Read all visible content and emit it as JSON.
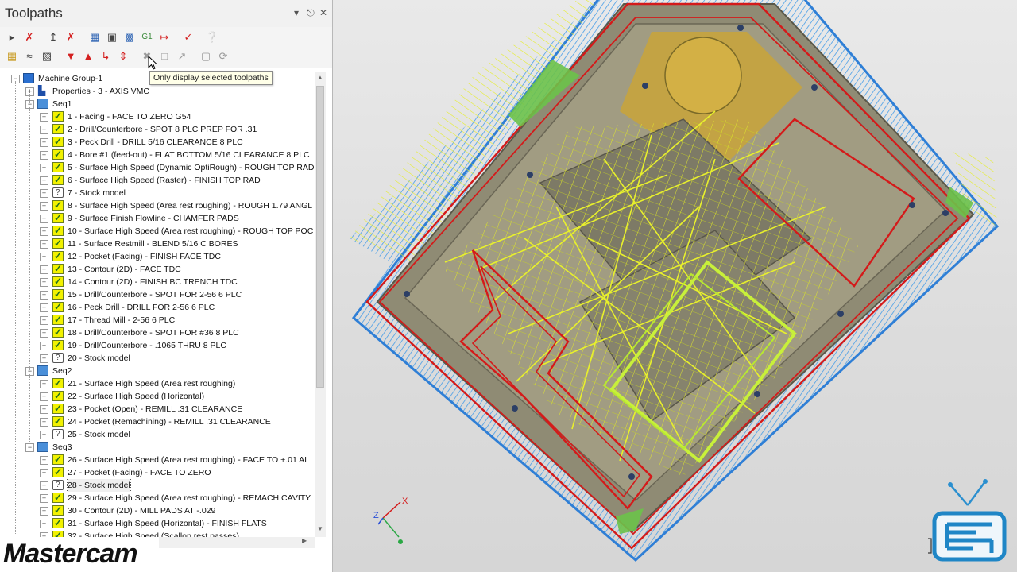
{
  "panel": {
    "title": "Toolpaths",
    "pin_icon": "pin-icon",
    "dropdown_icon": "chevron-down-icon",
    "close_icon": "close-icon"
  },
  "toolbar": {
    "row1": [
      "select-all-icon",
      "select-errors-icon",
      "regenerate-selected-icon",
      "regenerate-dirty-icon",
      "backplot-icon",
      "verify-icon",
      "simulate-icon",
      "post-icon",
      "g1-code-icon",
      "high-speed-icon",
      "help-icon"
    ],
    "row2": [
      "lock-icon",
      "toggle-display-icon",
      "toggle-posting-icon",
      "move-down-icon",
      "move-up-icon",
      "insert-arrow-icon",
      "scroll-icon",
      "only-display-selected-icon",
      "expand-icon",
      "collapse-icon",
      "display-options-icon",
      "refresh-icon"
    ],
    "tooltip": "Only display selected toolpaths"
  },
  "tree": {
    "machine_group": "Machine Group-1",
    "properties": "Properties - 3 - AXIS VMC",
    "seq1": "Seq1",
    "seq2": "Seq2",
    "seq3": "Seq3",
    "ops": [
      "1 - Facing - FACE TO ZERO G54",
      "2 - Drill/Counterbore - SPOT 8 PLC PREP FOR .31",
      "3 - Peck Drill - DRILL 5/16 CLEARANCE 8 PLC",
      "4 - Bore #1 (feed-out) - FLAT BOTTOM 5/16 CLEARANCE 8 PLC",
      "5 - Surface High Speed (Dynamic OptiRough) - ROUGH TOP RAD",
      "6 - Surface High Speed (Raster) - FINISH TOP RAD",
      "7 - Stock model",
      "8 - Surface High Speed (Area rest roughing) - ROUGH 1.79 ANGL",
      "9 - Surface Finish Flowline - CHAMFER PADS",
      "10 - Surface High Speed (Area rest roughing) - ROUGH TOP POC",
      "11 - Surface Restmill - BLEND 5/16 C BORES",
      "12 - Pocket (Facing) - FINISH FACE TDC",
      "13 - Contour (2D) - FACE TDC",
      "14 - Contour (2D) - FINISH BC TRENCH TDC",
      "15 - Drill/Counterbore - SPOT FOR 2-56 6 PLC",
      "16 - Peck Drill - DRILL FOR 2-56 6 PLC",
      "17 - Thread Mill - 2-56 6 PLC",
      "18 - Drill/Counterbore - SPOT FOR #36 8 PLC",
      "19 - Drill/Counterbore - .1065 THRU 8 PLC",
      "20 - Stock model",
      "21 - Surface High Speed (Area rest roughing)",
      "22 - Surface High Speed (Horizontal)",
      "23 - Pocket (Open) - REMILL .31 CLEARANCE",
      "24 - Pocket (Remachining) - REMILL .31 CLEARANCE",
      "25 - Stock model",
      "26 - Surface High Speed (Area rest roughing) - FACE TO +.01 AI",
      "27 - Pocket (Facing) - FACE TO ZERO",
      "28 - Stock model",
      "29 - Surface High Speed (Area rest roughing) - REMACH CAVITY",
      "30 - Contour (2D) - MILL PADS AT -.029",
      "31 - Surface High Speed (Horizontal) - FINISH FLATS",
      "32 - Surface High Speed (Scallop rest passes)"
    ]
  },
  "branding": {
    "logo_text": "Mastercam",
    "axis_labels": {
      "z": "Z",
      "x": "X"
    }
  },
  "colors": {
    "toolpath_yellow": "#e6ee2a",
    "toolpath_blue": "#3f9ae8",
    "contour_red": "#d41a1a",
    "part_gray": "#8a8775",
    "stock_gold": "#c9a43a",
    "tv_blue": "#1f86c6"
  }
}
